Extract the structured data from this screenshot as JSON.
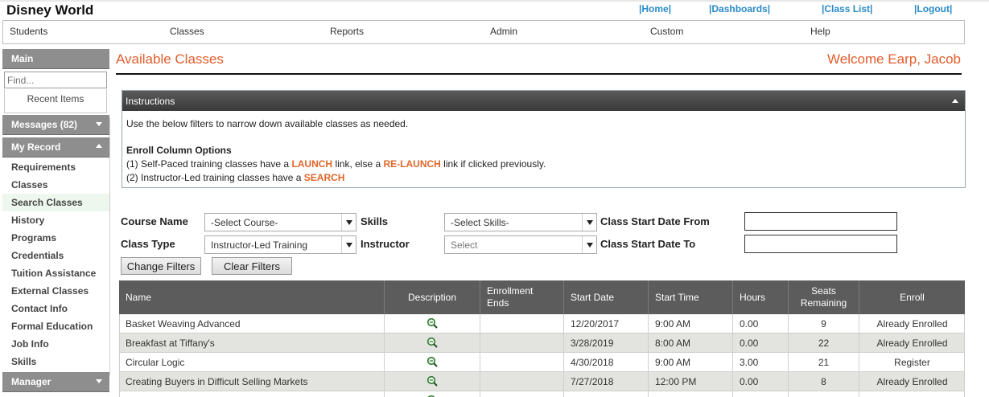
{
  "app": {
    "title": "Disney World"
  },
  "toplinks": {
    "home": "|Home|",
    "dashboards": "|Dashboards|",
    "class_list": "|Class List|",
    "logout": "|Logout|"
  },
  "menu": [
    "Students",
    "Classes",
    "Reports",
    "Admin",
    "Custom",
    "Help"
  ],
  "sidebar": {
    "main": "Main",
    "find_placeholder": "Find...",
    "recent": "Recent Items",
    "messages": "Messages (82)",
    "my_record": "My Record",
    "items": [
      "Requirements",
      "Classes",
      "Search Classes",
      "History",
      "Programs",
      "Credentials",
      "Tuition Assistance",
      "External Classes",
      "Contact Info",
      "Formal Education",
      "Job Info",
      "Skills"
    ],
    "active_item": "Search Classes",
    "manager": "Manager",
    "icons": {
      "expand": "chevron-down-icon",
      "collapse": "chevron-up-icon"
    }
  },
  "page": {
    "title": "Available Classes",
    "welcome": "Welcome Earp, Jacob"
  },
  "instructions": {
    "header": "Instructions",
    "line1": "Use the below filters to narrow down available classes as needed.",
    "enroll_heading": "Enroll Column Options",
    "line2_a": "(1) Self-Paced training classes have a ",
    "line2_b": "LAUNCH",
    "line2_c": " link, else a ",
    "line2_d": "RE-LAUNCH",
    "line2_e": " link if clicked previously.",
    "line3_a": "(2) Instructor-Led training classes have a ",
    "line3_b": "SEARCH"
  },
  "filters": {
    "course_name_label": "Course Name",
    "course_name_value": "-Select Course-",
    "skills_label": "Skills",
    "skills_value": "-Select Skills-",
    "start_from_label": "Class Start Date From",
    "start_from_value": "",
    "class_type_label": "Class Type",
    "class_type_value": "Instructor-Led Training",
    "instructor_label": "Instructor",
    "instructor_value": "Select",
    "start_to_label": "Class Start Date To",
    "start_to_value": "",
    "change_button": "Change Filters",
    "clear_button": "Clear Filters"
  },
  "table": {
    "headers": [
      "Name",
      "Description",
      "Enrollment Ends",
      "Start Date",
      "Start Time",
      "Hours",
      "Seats Remaining",
      "Enroll"
    ],
    "rows": [
      {
        "name": "Basket Weaving Advanced",
        "enrollment_ends": "",
        "start_date": "12/20/2017",
        "start_time": "9:00 AM",
        "hours": "0.00",
        "seats": "9",
        "enroll": "Already Enrolled"
      },
      {
        "name": "Breakfast at Tiffany's",
        "enrollment_ends": "",
        "start_date": "3/28/2019",
        "start_time": "8:00 AM",
        "hours": "0.00",
        "seats": "22",
        "enroll": "Already Enrolled"
      },
      {
        "name": "Circular Logic",
        "enrollment_ends": "",
        "start_date": "4/30/2018",
        "start_time": "9:00 AM",
        "hours": "3.00",
        "seats": "21",
        "enroll": "Register"
      },
      {
        "name": "Creating Buyers in Difficult Selling Markets",
        "enrollment_ends": "",
        "start_date": "7/27/2018",
        "start_time": "12:00 PM",
        "hours": "0.00",
        "seats": "8",
        "enroll": "Already Enrolled"
      },
      {
        "name": "",
        "enrollment_ends": "",
        "start_date": "",
        "start_time": "",
        "hours": "",
        "seats": "",
        "enroll": ""
      }
    ],
    "description_icon": "magnifier-icon",
    "colors": {
      "header_bg": "#5c5c5c",
      "alt_row": "#e3e3df"
    }
  },
  "colors": {
    "accent": "#e25d2c",
    "link": "#2a8ac8",
    "sidebar_head": "#8e8e8e"
  }
}
